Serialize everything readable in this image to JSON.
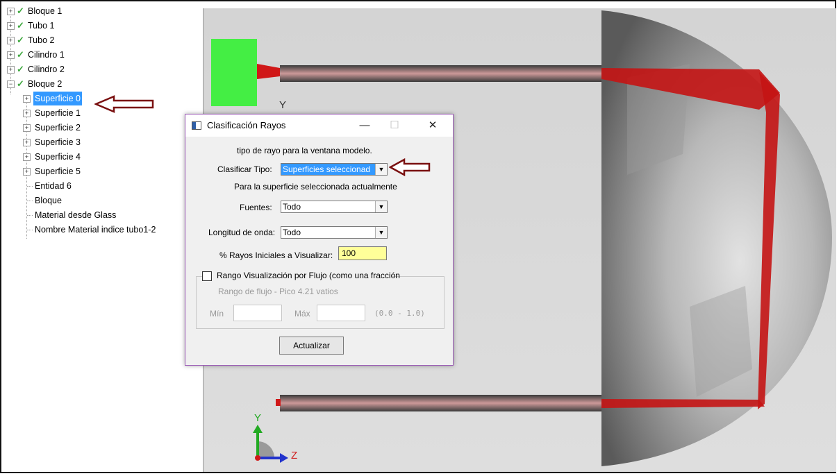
{
  "tree": {
    "items": [
      {
        "label": "Bloque 1"
      },
      {
        "label": "Tubo 1"
      },
      {
        "label": "Tubo 2"
      },
      {
        "label": "Cilindro 1"
      },
      {
        "label": "Cilindro 2"
      },
      {
        "label": "Bloque 2"
      }
    ],
    "children": [
      {
        "label": "Superficie 0"
      },
      {
        "label": "Superficie 1"
      },
      {
        "label": "Superficie 2"
      },
      {
        "label": "Superficie 3"
      },
      {
        "label": "Superficie 4"
      },
      {
        "label": "Superficie 5"
      },
      {
        "label": "Entidad 6"
      },
      {
        "label": "Bloque"
      },
      {
        "label": "Material desde Glass"
      },
      {
        "label": "Nombre Material indice tubo1-2"
      }
    ]
  },
  "viewport": {
    "axis_y_top": "Y",
    "axis_y": "Y",
    "axis_z": "Z"
  },
  "dialog": {
    "title": "Clasificación Rayos",
    "minimize": "—",
    "maximize": "☐",
    "close": "✕",
    "intro": "tipo de rayo para la ventana modelo.",
    "classify_label": "Clasificar Tipo:",
    "classify_value": "Superficies seleccionad",
    "subtitle": "Para la superficie seleccionada actualmente",
    "sources_label": "Fuentes:",
    "sources_value": "Todo",
    "wavelength_label": "Longitud de onda:",
    "wavelength_value": "Todo",
    "rays_label": "% Rayos Iniciales a Visualizar:",
    "rays_value": "100",
    "flux_checkbox_label": "Rango Visualización por Flujo (como una fracción",
    "flux_range_label": "Rango de flujo - Pico 4.21 vatios",
    "min_label": "Mín",
    "max_label": "Máx",
    "range_hint": "(0.0 - 1.0)",
    "update_button": "Actualizar"
  },
  "colors": {
    "selection": "#3399ff",
    "rays": "#d01818",
    "block": "#44ee44",
    "arrow": "#7a1010"
  }
}
